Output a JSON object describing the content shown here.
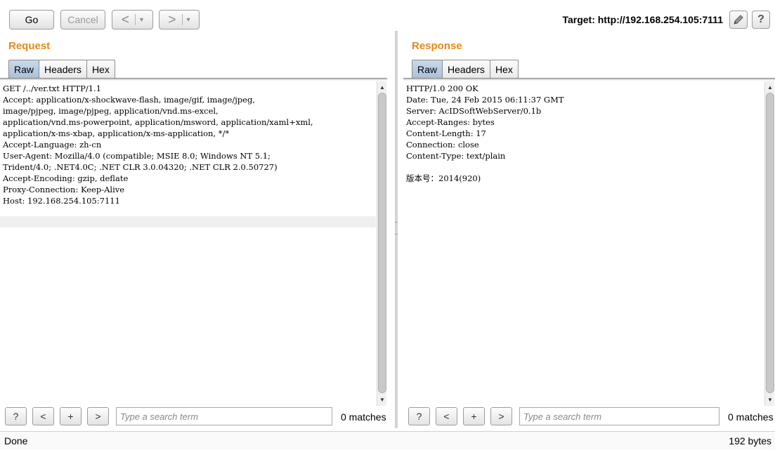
{
  "toolbar": {
    "go": "Go",
    "cancel": "Cancel",
    "back_arrow": "<",
    "forward_arrow": ">",
    "dropdown": "▾",
    "target": "Target: http://192.168.254.105:7111",
    "edit_icon": "pencil-icon",
    "help_icon": "?"
  },
  "request": {
    "title": "Request",
    "tabs": [
      "Raw",
      "Headers",
      "Hex"
    ],
    "active_tab": "Raw",
    "body": "GET /../ver.txt HTTP/1.1\nAccept: application/x-shockwave-flash, image/gif, image/jpeg,\nimage/pjpeg, image/pjpeg, application/vnd.ms-excel,\napplication/vnd.ms-powerpoint, application/msword, application/xaml+xml,\napplication/x-ms-xbap, application/x-ms-application, */*\nAccept-Language: zh-cn\nUser-Agent: Mozilla/4.0 (compatible; MSIE 8.0; Windows NT 5.1;\nTrident/4.0; .NET4.0C; .NET CLR 3.0.04320; .NET CLR 2.0.50727)\nAccept-Encoding: gzip, deflate\nProxy-Connection: Keep-Alive\nHost: 192.168.254.105:7111",
    "search": {
      "help": "?",
      "prev": "<",
      "add": "+",
      "next": ">",
      "placeholder": "Type a search term",
      "matches": "0 matches"
    }
  },
  "response": {
    "title": "Response",
    "tabs": [
      "Raw",
      "Headers",
      "Hex"
    ],
    "active_tab": "Raw",
    "body": "HTTP/1.0 200 OK\nDate: Tue, 24 Feb 2015 06:11:37 GMT\nServer: AcIDSoftWebServer/0.1b\nAccept-Ranges: bytes\nContent-Length: 17\nConnection: close\nContent-Type: text/plain\n\n版本号：2014(920)",
    "search": {
      "help": "?",
      "prev": "<",
      "add": "+",
      "next": ">",
      "placeholder": "Type a search term",
      "matches": "0 matches"
    }
  },
  "status": {
    "left": "Done",
    "right": "192 bytes"
  },
  "colors": {
    "title_accent": "#e58a1c",
    "active_tab": "#b7cbe0"
  }
}
